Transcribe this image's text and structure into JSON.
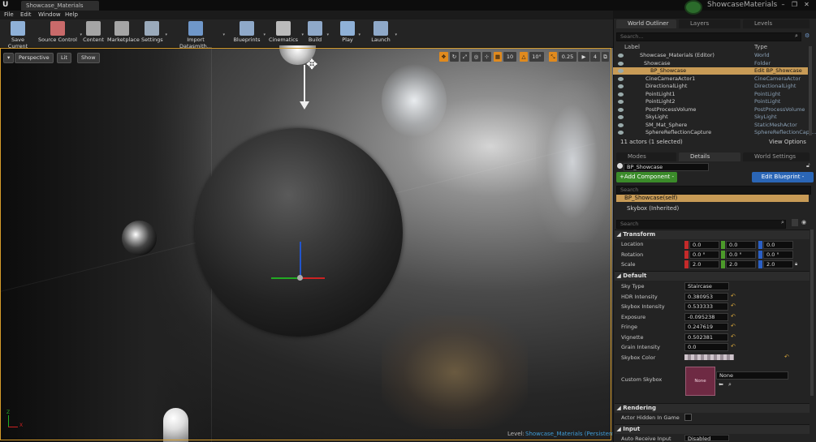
{
  "window": {
    "doc_tab": "Showcase_Materials",
    "project_name": "ShowcaseMaterials",
    "controls": [
      "–",
      "❐",
      "✕"
    ]
  },
  "menu": [
    "File",
    "Edit",
    "Window",
    "Help"
  ],
  "toolbar": [
    {
      "label": "Save Current",
      "icon": "save-icon",
      "color": "#8fb1d8"
    },
    {
      "label": "Source Control",
      "icon": "source-control-icon",
      "color": "#c96a6a"
    },
    {
      "label": "Content",
      "icon": "content-icon",
      "color": "#a5a5a5"
    },
    {
      "label": "Marketplace",
      "icon": "marketplace-icon",
      "color": "#a5a5a5"
    },
    {
      "label": "Settings",
      "icon": "gear-icon",
      "color": "#9aaabb"
    },
    {
      "label": "Import Datasmith...",
      "icon": "datasmith-icon",
      "color": "#6f97c9"
    },
    {
      "label": "Blueprints",
      "icon": "blueprints-icon",
      "color": "#8fa9c9"
    },
    {
      "label": "Cinematics",
      "icon": "cinematics-icon",
      "color": "#bbbbbb"
    },
    {
      "label": "Build",
      "icon": "build-icon",
      "color": "#8fa9c9"
    },
    {
      "label": "Play",
      "icon": "play-icon",
      "color": "#8fb1d8"
    },
    {
      "label": "Launch",
      "icon": "launch-icon",
      "color": "#8fa9c9"
    }
  ],
  "viewport": {
    "perspective": "Perspective",
    "lit": "Lit",
    "show": "Show",
    "grid_snap": "10",
    "rot_snap": "10°",
    "scale_snap": "0.25",
    "camera_speed": "4",
    "level_label": "Level:",
    "level_name": "Showcase_Materials (Persistent)",
    "axis_x": "X",
    "axis_y": "Z"
  },
  "outliner": {
    "tabs": [
      "World Outliner",
      "Layers",
      "Levels"
    ],
    "search_placeholder": "Search...",
    "col_label": "Label",
    "col_type": "Type",
    "rows": [
      {
        "label": "Showcase_Materials (Editor)",
        "type": "World"
      },
      {
        "label": "Showcase",
        "type": "Folder"
      },
      {
        "label": "BP_Showcase",
        "type": "Edit BP_Showcase"
      },
      {
        "label": "CineCameraActor1",
        "type": "CineCameraActor"
      },
      {
        "label": "DirectionalLight",
        "type": "DirectionalLight"
      },
      {
        "label": "PointLight1",
        "type": "PointLight"
      },
      {
        "label": "PointLight2",
        "type": "PointLight"
      },
      {
        "label": "PostProcessVolume",
        "type": "PostProcessVolume"
      },
      {
        "label": "SkyLight",
        "type": "SkyLight"
      },
      {
        "label": "SM_Mat_Sphere",
        "type": "StaticMeshActor"
      },
      {
        "label": "SphereReflectionCapture",
        "type": "SphereReflectionCapt..."
      }
    ],
    "status": "11 actors (1 selected)",
    "view_options": "View Options"
  },
  "details": {
    "tabs": [
      "Modes",
      "Details",
      "World Settings"
    ],
    "actor_name": "BP_Showcase",
    "add_component": "+Add Component -",
    "edit_blueprint": "Edit Blueprint -",
    "search_placeholder": "Search",
    "components": [
      "BP_Showcase(self)",
      "Skybox (Inherited)"
    ],
    "prop_search_placeholder": "Search",
    "transform": {
      "title": "Transform",
      "location_label": "Location",
      "rotation_label": "Rotation",
      "scale_label": "Scale",
      "location": [
        "0.0",
        "0.0",
        "0.0"
      ],
      "rotation": [
        "0.0 °",
        "0.0 °",
        "0.0 °"
      ],
      "scale": [
        "2.0",
        "2.0",
        "2.0"
      ]
    },
    "default": {
      "title": "Default",
      "props": [
        {
          "label": "Sky Type",
          "value": "Staircase"
        },
        {
          "label": "HDR Intensity",
          "value": "0.380953"
        },
        {
          "label": "Skybox Intensity",
          "value": "0.533333"
        },
        {
          "label": "Exposure",
          "value": "-0.095238"
        },
        {
          "label": "Fringe",
          "value": "0.247619"
        },
        {
          "label": "Vignette",
          "value": "0.502381"
        },
        {
          "label": "Grain Intensity",
          "value": "0.0"
        }
      ],
      "skybox_color_label": "Skybox Color",
      "custom_skybox_label": "Custom Skybox",
      "custom_skybox_value": "None",
      "thumb_text": "None"
    },
    "rendering": {
      "title": "Rendering",
      "actor_hidden_label": "Actor Hidden In Game"
    },
    "input": {
      "title": "Input",
      "auto_receive_label": "Auto Receive Input",
      "auto_receive_value": "Disabled"
    }
  }
}
